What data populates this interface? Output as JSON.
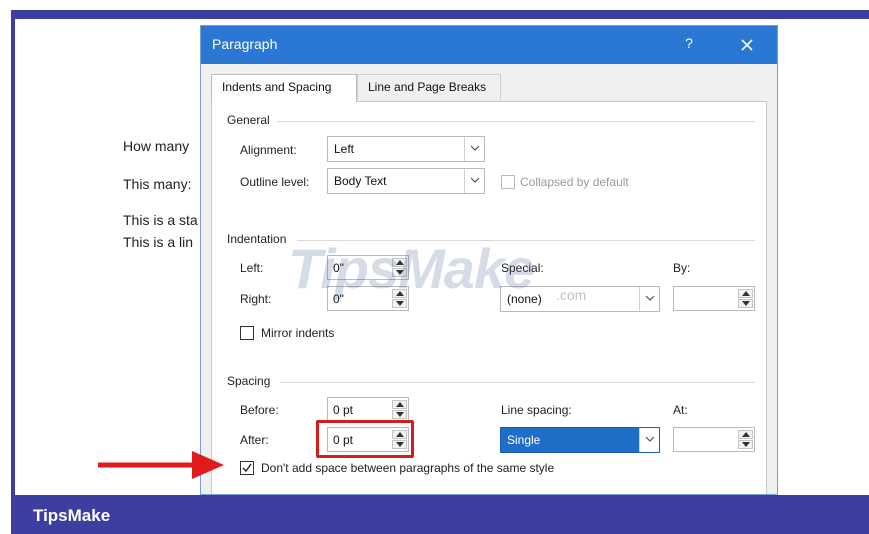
{
  "document": {
    "lines": [
      "How many",
      "This many:",
      "This is a sta",
      "This is a lin"
    ]
  },
  "dialog": {
    "title": "Paragraph",
    "help_label": "?",
    "tabs": [
      {
        "label": "Indents and Spacing",
        "active": true
      },
      {
        "label": "Line and Page Breaks",
        "active": false
      }
    ],
    "general": {
      "section_label": "General",
      "alignment_label": "Alignment:",
      "alignment_value": "Left",
      "outline_label": "Outline level:",
      "outline_value": "Body Text",
      "collapsed_label": "Collapsed by default",
      "collapsed_checked": false
    },
    "indentation": {
      "section_label": "Indentation",
      "left_label": "Left:",
      "left_value": "0\"",
      "right_label": "Right:",
      "right_value": "0\"",
      "special_label": "Special:",
      "special_value": "(none)",
      "by_label": "By:",
      "by_value": "",
      "mirror_label": "Mirror indents",
      "mirror_checked": false
    },
    "spacing": {
      "section_label": "Spacing",
      "before_label": "Before:",
      "before_value": "0 pt",
      "after_label": "After:",
      "after_value": "0 pt",
      "line_spacing_label": "Line spacing:",
      "line_spacing_value": "Single",
      "at_label": "At:",
      "at_value": "",
      "dont_add_label": "Don't add space between paragraphs of the same style",
      "dont_add_checked": true
    }
  },
  "watermark": {
    "text": "TipsMake",
    "suffix": ".com"
  },
  "brand": {
    "name": "TipsMake"
  },
  "colors": {
    "titlebar": "#2b78d4",
    "frame": "#3c3fa0",
    "highlight": "#d71c1c",
    "selection": "#1f6fc9"
  }
}
